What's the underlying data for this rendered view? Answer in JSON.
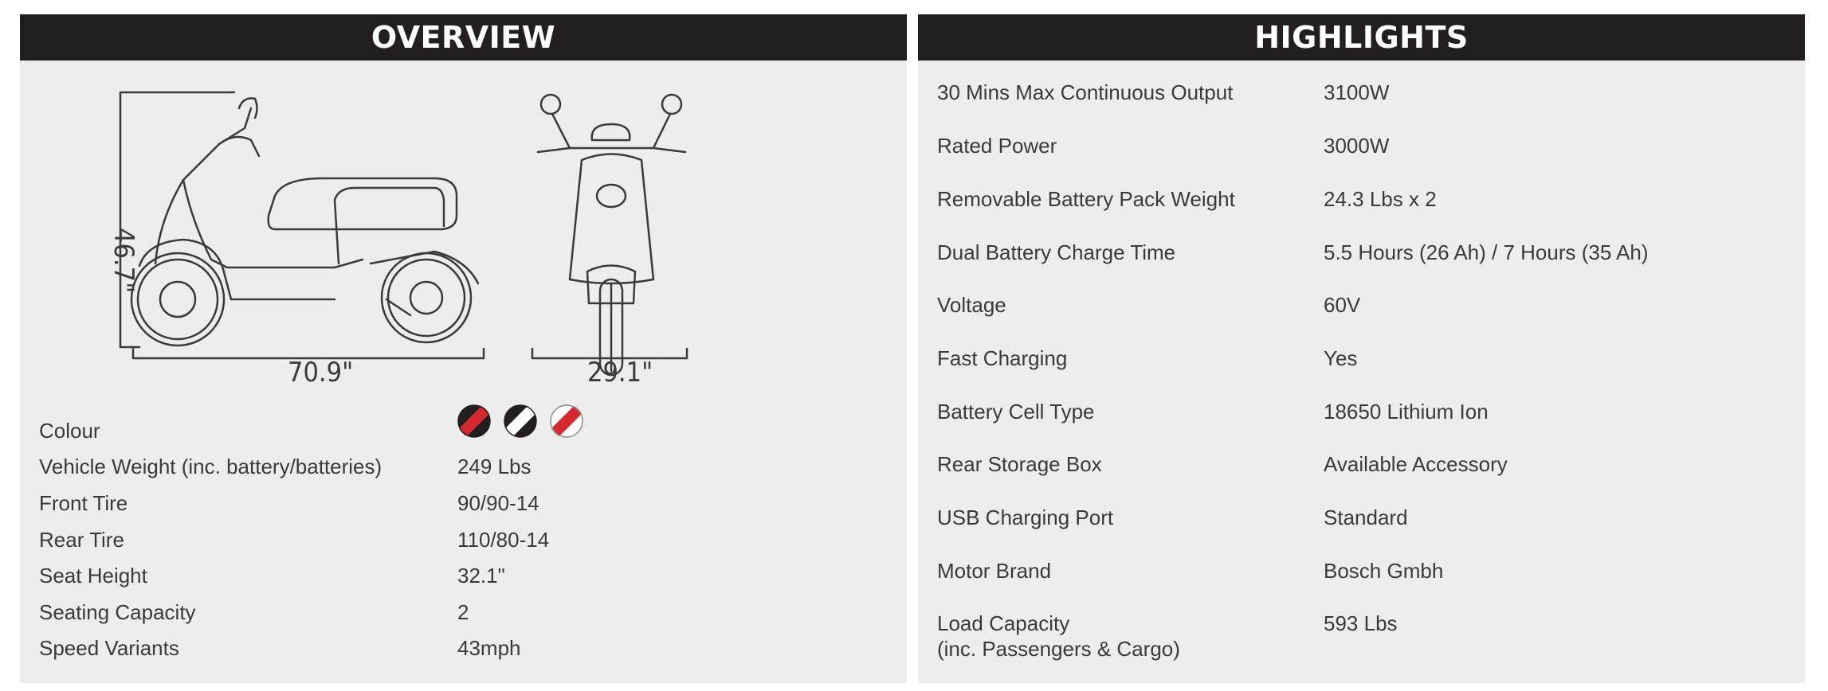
{
  "overview": {
    "title": "OVERVIEW",
    "dimensions": {
      "length": "70.9\"",
      "width": "29.1\"",
      "height": "46.7\""
    },
    "specs": [
      {
        "label": "Colour",
        "value": ""
      },
      {
        "label": "Vehicle Weight (inc. battery/batteries)",
        "value": "249 Lbs"
      },
      {
        "label": "Front Tire",
        "value": "90/90-14"
      },
      {
        "label": "Rear Tire",
        "value": "110/80-14"
      },
      {
        "label": "Seat Height",
        "value": "32.1\""
      },
      {
        "label": "Seating Capacity",
        "value": "2"
      },
      {
        "label": "Speed Variants",
        "value": "43mph"
      }
    ],
    "colour_swatches": [
      {
        "name": "red-black",
        "primary": "#d42a2f",
        "secondary": "#231f20"
      },
      {
        "name": "black-white",
        "primary": "#231f20",
        "secondary": "#ffffff"
      },
      {
        "name": "white-red",
        "primary": "#ffffff",
        "secondary": "#d42a2f"
      }
    ]
  },
  "highlights": {
    "title": "HIGHLIGHTS",
    "rows": [
      {
        "label": "30 Mins Max Continuous Output",
        "value": "3100W"
      },
      {
        "label": "Rated Power",
        "value": "3000W"
      },
      {
        "label": "Removable Battery Pack Weight",
        "value": "24.3 Lbs x 2"
      },
      {
        "label": "Dual Battery Charge Time",
        "value": "5.5 Hours (26 Ah) / 7 Hours (35 Ah)"
      },
      {
        "label": "Voltage",
        "value": "60V"
      },
      {
        "label": "Fast Charging",
        "value": "Yes"
      },
      {
        "label": "Battery Cell Type",
        "value": "18650 Lithium Ion"
      },
      {
        "label": "Rear Storage Box",
        "value": "Available Accessory"
      },
      {
        "label": "USB Charging Port",
        "value": "Standard"
      },
      {
        "label": "Motor Brand",
        "value": "Bosch Gmbh"
      },
      {
        "label": "Load Capacity",
        "sub": "(inc. Passengers & Cargo)",
        "value": "593 Lbs"
      }
    ]
  },
  "colors": {
    "header_bg": "#231f20",
    "panel_bg": "#ecedec",
    "text": "#3a3a3a",
    "accent_red": "#d42a2f"
  }
}
